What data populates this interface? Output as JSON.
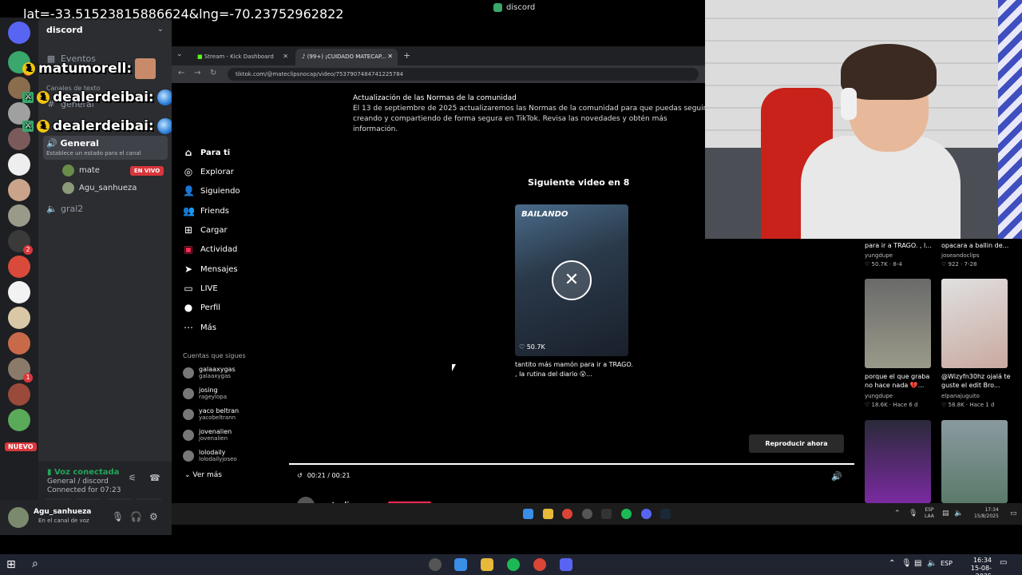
{
  "overlay": {
    "gps": "lat=-33.51523815886624&lng=-70.23752962822",
    "chat": [
      {
        "user": "matumorell:"
      },
      {
        "user": "dealerdeibai:"
      },
      {
        "user": "dealerdeibai:"
      }
    ],
    "badge_counts": [
      "1",
      "1",
      "1"
    ]
  },
  "window_title": "discord",
  "discord": {
    "server_name": "discord",
    "events_label": "Eventos",
    "text_channels_header": "Canales de texto",
    "text_channel": "general",
    "voice_channel": "General",
    "voice_channel_sub": "Establece un estado para el canal",
    "voice_users": [
      "mate",
      "Agu_sanhueza"
    ],
    "live_label": "EN VIVO",
    "other_channel": "gral2",
    "new_label": "NUEVO",
    "server_badges": [
      "1",
      "2",
      "1"
    ],
    "voice_connected": "Voz conectada",
    "voice_location": "General / discord",
    "connected_for": "Connected for 07:23",
    "user_name": "Agu_sanhueza",
    "user_status": "En el canal de voz"
  },
  "browser": {
    "tabs": [
      {
        "label": "Stream - Kick Dashboard"
      },
      {
        "label": "(99+) ¡CUIDADO MATECAP..."
      }
    ],
    "url": "tiktok.com/@mateclipsnocap/video/7537907484741225784"
  },
  "tiktok": {
    "nav": [
      "Para ti",
      "Explorar",
      "Siguiendo",
      "Friends",
      "Cargar",
      "Actividad",
      "Mensajes",
      "LIVE",
      "Perfil",
      "Más"
    ],
    "following_header": "Cuentas que sigues",
    "following": [
      {
        "name": "galaaxygas",
        "user": "galaaxygas"
      },
      {
        "name": "josing",
        "user": "rageylopa"
      },
      {
        "name": "yaco beltran",
        "user": "yacobeltrann"
      },
      {
        "name": "jovenalien",
        "user": "jovenalien"
      },
      {
        "name": "lolodaily",
        "user": "lolodailyjoseo"
      }
    ],
    "see_more": "Ver más",
    "notice_title": "Actualización de las Normas de la comunidad",
    "notice_body": "El 13 de septiembre de 2025 actualizaremos las Normas de la comunidad para que puedas seguir creando y compartiendo de forma segura en TikTok. Revisa las novedades y obtén más información.",
    "next_video_title": "Siguiente video en 8",
    "card_tag": "BAILANDO",
    "card_likes": "♡ 50.7K",
    "card_caption": "tantito más mamón para ir a TRAGO. , la rutina del diario 😮...",
    "play_now": "Reproducir ahora",
    "time": "00:21 / 00:21",
    "author": "mateclipsnocap",
    "related": [
      {
        "caption": "para ir a TRAGO. , l...",
        "user": "yungdupe",
        "meta": "♡ 50.7K · 8-4"
      },
      {
        "caption": "opacara a ballin de...",
        "user": "joseandoclips",
        "meta": "♡ 922 · 7-28"
      },
      {
        "caption": "porque el que graba no hace nada 💔...",
        "user": "yungdupe",
        "meta": "♡ 18.6K · Hace 6 d"
      },
      {
        "caption": "@Wizyfn30hz ojalá te guste el edit Bro...",
        "user": "elpanajuguito",
        "meta": "♡ 58.8K · Hace 1 d"
      }
    ]
  },
  "inner_taskbar": {
    "lang": [
      "ESP",
      "LAA"
    ],
    "time": "17:34",
    "date": "15/8/2025"
  },
  "taskbar": {
    "lang": "ESP",
    "time": "16:34",
    "date": "15-08-2025"
  }
}
